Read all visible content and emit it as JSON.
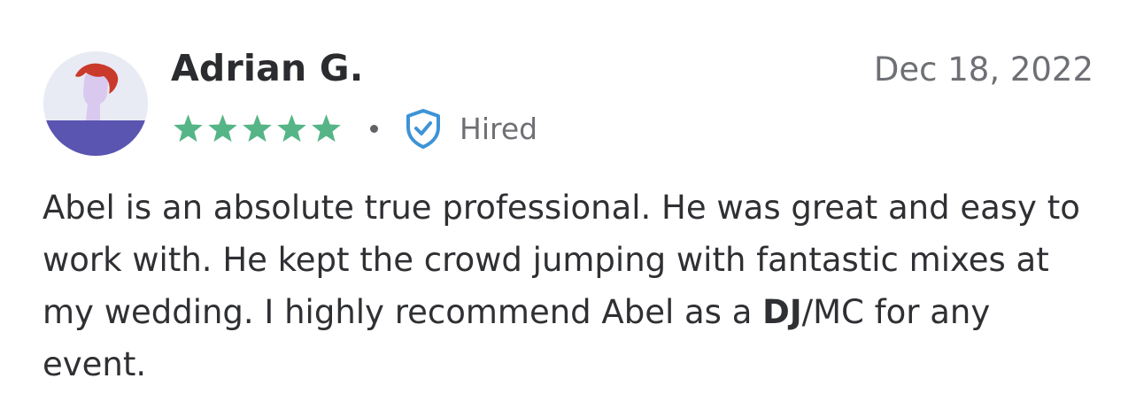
{
  "review": {
    "reviewer_name": "Adrian G.",
    "date": "Dec 18, 2022",
    "rating": 5,
    "rating_max": 5,
    "badge_label": "Hired",
    "body_before": "Abel is an absolute true professional. He was great and easy to work with. He kept the crowd jumping with fantastic mixes at my wedding. I highly recommend Abel as a ",
    "body_bold": "DJ",
    "body_after": "/MC for any event."
  },
  "icons": {
    "avatar": "default-user-avatar",
    "star": "star-icon",
    "badge": "shield-check-icon"
  },
  "colors": {
    "star": "#56b587",
    "shield": "#3d93d6",
    "name": "#2b2c2f",
    "muted": "#6e7075",
    "avatar_base": "#5a55b0",
    "avatar_hair": "#c93a2b"
  }
}
